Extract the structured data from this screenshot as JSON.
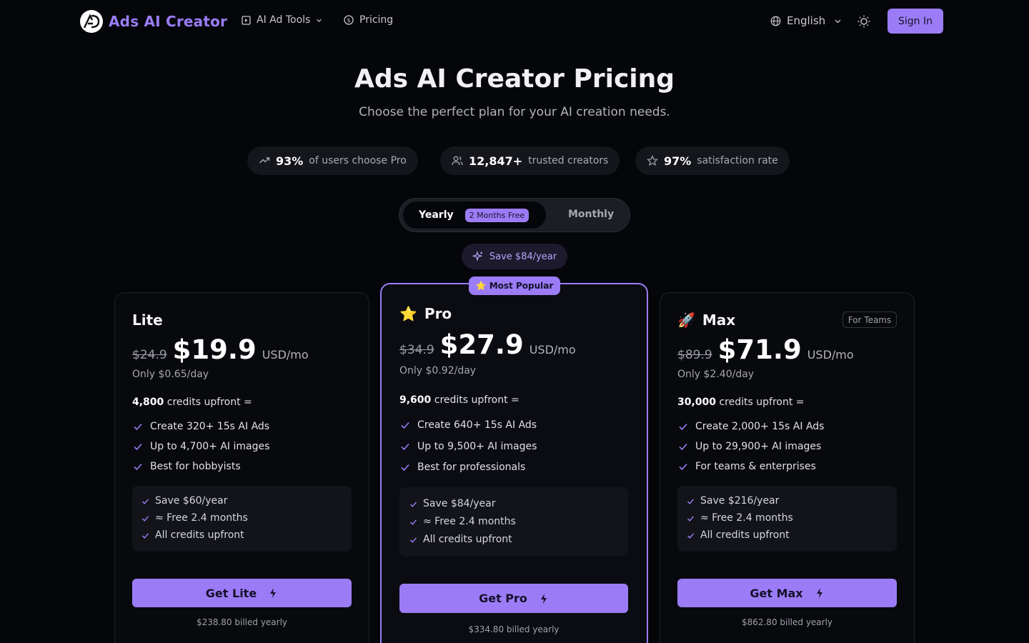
{
  "app": {
    "name": "Ads AI Creator"
  },
  "nav": {
    "tools": "AI Ad Tools",
    "pricing": "Pricing",
    "language": "English",
    "sign_in": "Sign In"
  },
  "hero": {
    "title": "Ads AI Creator Pricing",
    "subtitle": "Choose the perfect plan for your AI creation needs."
  },
  "stats": [
    {
      "value": "93%",
      "label": "of users choose Pro",
      "icon": "trending-up-icon"
    },
    {
      "value": "12,847+",
      "label": "trusted creators",
      "icon": "users-icon"
    },
    {
      "value": "97%",
      "label": "satisfaction rate",
      "icon": "star-icon"
    }
  ],
  "billing": {
    "yearly": "Yearly",
    "free_badge": "2 Months Free",
    "monthly": "Monthly",
    "save": "Save $84/year"
  },
  "popular_badge": "Most Popular",
  "plans": [
    {
      "name": "Lite",
      "old_price": "$24.9",
      "price": "$19.9",
      "unit": "USD/mo",
      "per_day": "Only $0.65/day",
      "credits_bold": "4,800",
      "credits_text": "credits upfront =",
      "features": [
        "Create 320+ 15s AI Ads",
        "Up to 4,700+ AI images",
        "Best for hobbyists"
      ],
      "perks": [
        "Save $60/year",
        "≈ Free 2.4 months",
        "All credits upfront"
      ],
      "cta": "Get Lite",
      "billed": "$238.80 billed yearly"
    },
    {
      "name": "Pro",
      "old_price": "$34.9",
      "price": "$27.9",
      "unit": "USD/mo",
      "per_day": "Only $0.92/day",
      "credits_bold": "9,600",
      "credits_text": "credits upfront =",
      "features": [
        "Create 640+ 15s AI Ads",
        "Up to 9,500+ AI images",
        "Best for professionals"
      ],
      "perks": [
        "Save $84/year",
        "≈ Free 2.4 months",
        "All credits upfront"
      ],
      "cta": "Get Pro",
      "billed": "$334.80 billed yearly"
    },
    {
      "name": "Max",
      "tag": "For Teams",
      "old_price": "$89.9",
      "price": "$71.9",
      "unit": "USD/mo",
      "per_day": "Only $2.40/day",
      "credits_bold": "30,000",
      "credits_text": "credits upfront =",
      "features": [
        "Create 2,000+ 15s AI Ads",
        "Up to 29,900+ AI images",
        "For teams & enterprises"
      ],
      "perks": [
        "Save $216/year",
        "≈ Free 2.4 months",
        "All credits upfront"
      ],
      "cta": "Get Max",
      "billed": "$862.80 billed yearly"
    }
  ],
  "colors": {
    "accent": "#9b7cf6",
    "background": "#05060a"
  }
}
